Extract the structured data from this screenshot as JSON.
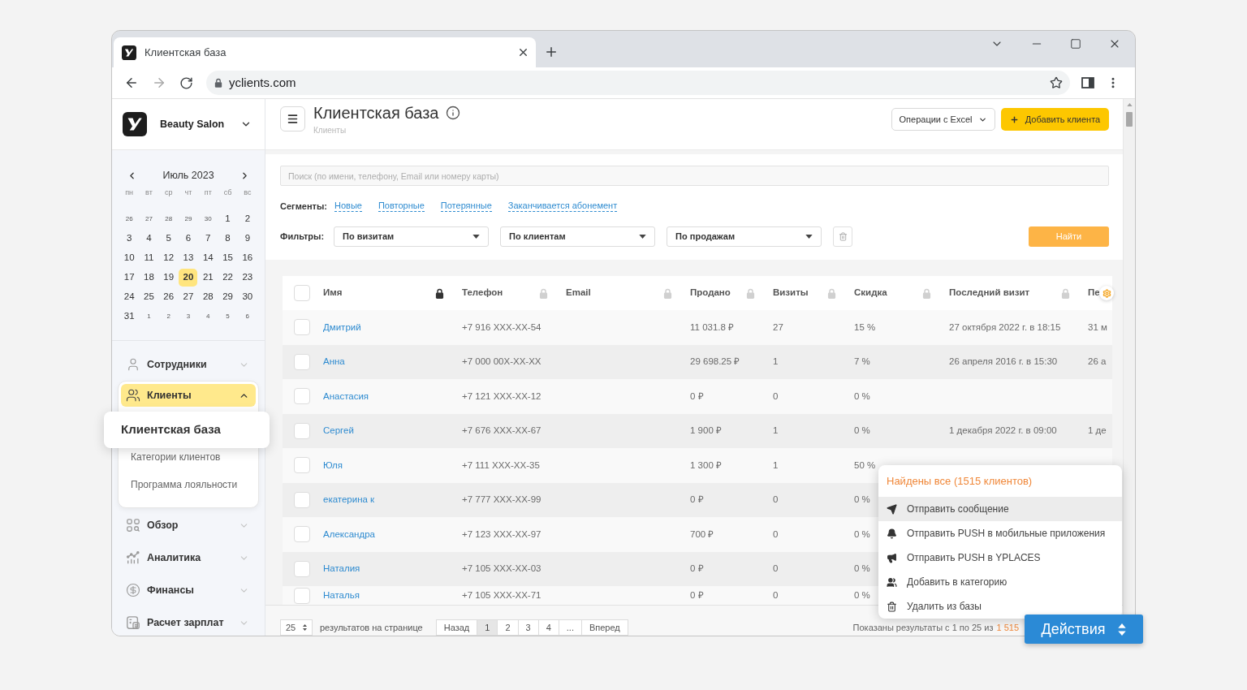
{
  "browser": {
    "tab_title": "Клиентская база",
    "url": "yclients.com",
    "back_enabled": true,
    "forward_enabled": false,
    "bookmarked": false
  },
  "sidebar": {
    "salon": "Beauty Salon",
    "calendar": {
      "month": "Июль 2023",
      "weekdays": [
        "пн",
        "вт",
        "ср",
        "чт",
        "пт",
        "сб",
        "вс"
      ],
      "days": [
        {
          "day": "26",
          "other_month": true,
          "selected": false
        },
        {
          "day": "27",
          "other_month": true,
          "selected": false
        },
        {
          "day": "28",
          "other_month": true,
          "selected": false
        },
        {
          "day": "29",
          "other_month": true,
          "selected": false
        },
        {
          "day": "30",
          "other_month": true,
          "selected": false
        },
        {
          "day": "1",
          "other_month": false,
          "selected": false
        },
        {
          "day": "2",
          "other_month": false,
          "selected": false
        },
        {
          "day": "3",
          "other_month": false,
          "selected": false
        },
        {
          "day": "4",
          "other_month": false,
          "selected": false
        },
        {
          "day": "5",
          "other_month": false,
          "selected": false
        },
        {
          "day": "6",
          "other_month": false,
          "selected": false
        },
        {
          "day": "7",
          "other_month": false,
          "selected": false
        },
        {
          "day": "8",
          "other_month": false,
          "selected": false
        },
        {
          "day": "9",
          "other_month": false,
          "selected": false
        },
        {
          "day": "10",
          "other_month": false,
          "selected": false
        },
        {
          "day": "11",
          "other_month": false,
          "selected": false
        },
        {
          "day": "12",
          "other_month": false,
          "selected": false
        },
        {
          "day": "13",
          "other_month": false,
          "selected": false
        },
        {
          "day": "14",
          "other_month": false,
          "selected": false
        },
        {
          "day": "15",
          "other_month": false,
          "selected": false
        },
        {
          "day": "16",
          "other_month": false,
          "selected": false
        },
        {
          "day": "17",
          "other_month": false,
          "selected": false
        },
        {
          "day": "18",
          "other_month": false,
          "selected": false
        },
        {
          "day": "19",
          "other_month": false,
          "selected": false
        },
        {
          "day": "20",
          "other_month": false,
          "selected": true
        },
        {
          "day": "21",
          "other_month": false,
          "selected": false
        },
        {
          "day": "22",
          "other_month": false,
          "selected": false
        },
        {
          "day": "23",
          "other_month": false,
          "selected": false
        },
        {
          "day": "24",
          "other_month": false,
          "selected": false
        },
        {
          "day": "25",
          "other_month": false,
          "selected": false
        },
        {
          "day": "26",
          "other_month": false,
          "selected": false
        },
        {
          "day": "27",
          "other_month": false,
          "selected": false
        },
        {
          "day": "28",
          "other_month": false,
          "selected": false
        },
        {
          "day": "29",
          "other_month": false,
          "selected": false
        },
        {
          "day": "30",
          "other_month": false,
          "selected": false
        },
        {
          "day": "31",
          "other_month": false,
          "selected": false
        },
        {
          "day": "1",
          "other_month": true,
          "selected": false
        },
        {
          "day": "2",
          "other_month": true,
          "selected": false
        },
        {
          "day": "3",
          "other_month": true,
          "selected": false
        },
        {
          "day": "4",
          "other_month": true,
          "selected": false
        },
        {
          "day": "5",
          "other_month": true,
          "selected": false
        },
        {
          "day": "6",
          "other_month": true,
          "selected": false
        }
      ]
    },
    "nav": [
      {
        "label": "Сотрудники",
        "selected": false,
        "expanded": false
      },
      {
        "label": "Клиенты",
        "selected": true,
        "expanded": true,
        "children": [
          {
            "label": "Клиентская база",
            "selected": true
          },
          {
            "label": "Категории клиентов",
            "selected": false
          },
          {
            "label": "Программа лояльности",
            "selected": false
          }
        ]
      },
      {
        "label": "Обзор",
        "selected": false,
        "expanded": false
      },
      {
        "label": "Аналитика",
        "selected": false,
        "expanded": false
      },
      {
        "label": "Финансы",
        "selected": false,
        "expanded": false
      },
      {
        "label": "Расчет зарплат",
        "selected": false,
        "expanded": false
      }
    ]
  },
  "header": {
    "title": "Клиентская база",
    "breadcrumb": "Клиенты",
    "excel_button": "Операции с Excel",
    "add_button": "Добавить клиента"
  },
  "filters": {
    "search_placeholder": "Поиск (по имени, телефону, Email или номеру карты)",
    "segments_label": "Сегменты:",
    "segments": [
      "Новые",
      "Повторные",
      "Потерянные",
      "Заканчивается абонемент"
    ],
    "filters_label": "Фильтры:",
    "selects": [
      "По визитам",
      "По клиентам",
      "По продажам"
    ],
    "find_button": "Найти"
  },
  "table": {
    "select_all_checked": false,
    "columns": [
      {
        "label": "Имя",
        "locked": true
      },
      {
        "label": "Телефон",
        "locked": false
      },
      {
        "label": "Email",
        "locked": false
      },
      {
        "label": "Продано",
        "locked": false
      },
      {
        "label": "Визиты",
        "locked": false
      },
      {
        "label": "Скидка",
        "locked": false
      },
      {
        "label": "Последний визит",
        "locked": false
      },
      {
        "label": "Пе"
      }
    ],
    "rows": [
      {
        "checked": false,
        "name": "Дмитрий",
        "phone": "+7 916 XXX-XX-54",
        "sold": "11 031.8 ₽",
        "visits": "27",
        "discount": "15 %",
        "last_visit": "27 октября 2022 г. в 18:15",
        "column_9": "31 м"
      },
      {
        "checked": false,
        "name": "Анна",
        "phone": "+7 000 00X-XX-XX",
        "sold": "29 698.25 ₽",
        "visits": "1",
        "discount": "7 %",
        "last_visit": "26 апреля 2016 г. в 15:30",
        "column_9": "26 а"
      },
      {
        "checked": false,
        "name": "Анастасия",
        "phone": "+7 121 XXX-XX-12",
        "sold": "0 ₽",
        "visits": "0",
        "discount": "0 %"
      },
      {
        "checked": false,
        "name": "Сергей",
        "phone": "+7 676 XXX-XX-67",
        "sold": "1 900 ₽",
        "visits": "1",
        "discount": "0 %",
        "last_visit": "1 декабря 2022 г. в 09:00",
        "column_9": "1 де"
      },
      {
        "checked": false,
        "name": "Юля",
        "phone": "+7 111 XXX-XX-35",
        "sold": "1 300 ₽",
        "visits": "1",
        "discount": "50 %"
      },
      {
        "checked": false,
        "name": "екатерина к",
        "phone": "+7 777 XXX-XX-99",
        "sold": "0 ₽",
        "visits": "0",
        "discount": "0 %"
      },
      {
        "checked": false,
        "name": "Александра",
        "phone": "+7 123 XXX-XX-97",
        "sold": "700 ₽",
        "visits": "0",
        "discount": "0 %"
      },
      {
        "checked": false,
        "name": "Наталия",
        "phone": "+7 105 XXX-XX-03",
        "sold": "0 ₽",
        "visits": "0",
        "discount": "0 %"
      },
      {
        "checked": false,
        "name": "Наталья",
        "phone": "+7 105 XXX-XX-71",
        "sold": "0 ₽",
        "visits": "0",
        "discount": "0 %"
      }
    ]
  },
  "pagination": {
    "per_page": "25",
    "per_page_label": "результатов на странице",
    "pages": [
      {
        "label": "Назад",
        "selected": false
      },
      {
        "label": "1",
        "selected": true
      },
      {
        "label": "2",
        "selected": false
      },
      {
        "label": "3",
        "selected": false
      },
      {
        "label": "4",
        "selected": false
      },
      {
        "label": "...",
        "selected": false
      },
      {
        "label": "Вперед",
        "selected": false
      }
    ],
    "summary": "Показаны результаты с 1 по 25 из",
    "total": "1 515"
  },
  "actions_menu": {
    "title": "Найдены все (1515 клиентов)",
    "items": [
      {
        "label": "Отправить сообщение",
        "highlighted": true
      },
      {
        "label": "Отправить PUSH в мобильные приложения",
        "highlighted": false
      },
      {
        "label": "Отправить PUSH в YPLACES",
        "highlighted": false
      },
      {
        "label": "Добавить в категорию",
        "highlighted": false
      },
      {
        "label": "Удалить из базы",
        "highlighted": false
      }
    ]
  },
  "actions_button": "Действия"
}
